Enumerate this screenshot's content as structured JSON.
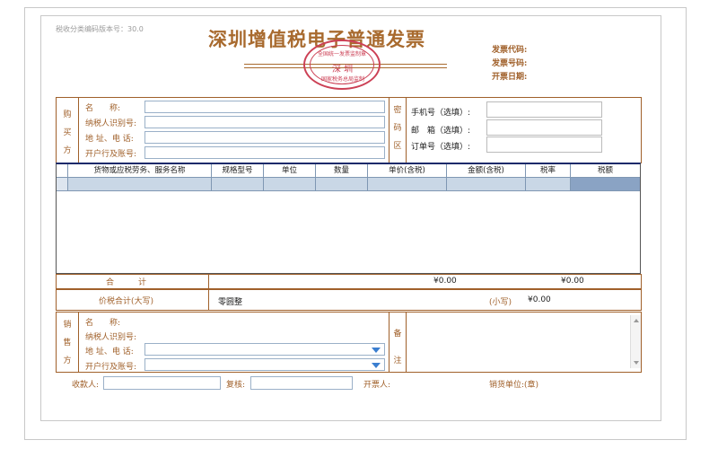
{
  "header": {
    "version_label": "税收分类编码版本号：30.0",
    "title_main": "深圳",
    "title_rest": "增值税电子普通发票",
    "invoice_code_label": "发票代码:",
    "invoice_number_label": "发票号码:",
    "issue_date_label": "开票日期:"
  },
  "seal": {
    "top_text": "全国统一发票监制章",
    "center_text": "深 圳",
    "bottom_text": "国家税务总局监制"
  },
  "buyer": {
    "side_label": [
      "购",
      "买",
      "方"
    ],
    "name_label": "名　　称:",
    "tax_id_label": "纳税人识别号:",
    "address_phone_label": "地 址、电 话:",
    "bank_account_label": "开户行及账号:"
  },
  "password_area": {
    "side_label": [
      "密",
      "码",
      "区"
    ],
    "phone_label": "手机号（选填）:",
    "email_label": "邮　箱（选填）:",
    "order_label": "订单号（选填）:"
  },
  "items_table": {
    "columns": [
      "货物或应税劳务、服务名称",
      "规格型号",
      "单位",
      "数量",
      "单价(含税)",
      "金额(含税)",
      "税率",
      "税额"
    ]
  },
  "totals": {
    "total_label": "合　　　计",
    "amount": "¥0.00",
    "tax": "¥0.00",
    "capital_label": "价税合计(大写)",
    "capital_value": "零圆整",
    "small_label": "(小写)",
    "small_value": "¥0.00"
  },
  "seller": {
    "side_label": [
      "销",
      "售",
      "方"
    ],
    "name_label": "名　　称:",
    "tax_id_label": "纳税人识别号:",
    "address_phone_label": "地 址、电 话:",
    "bank_account_label": "开户行及账号:"
  },
  "remarks": {
    "side_label": [
      "备",
      "注"
    ]
  },
  "footer": {
    "payee_label": "收款人:",
    "reviewer_label": "复核:",
    "drawer_label": "开票人:",
    "seller_unit_label": "销货单位:(章)"
  },
  "colors": {
    "accent": "#a0602a",
    "seal": "#cc4055",
    "grid_header_line": "#1a2a6a",
    "row_highlight": "#c9d7e6",
    "tax_cell": "#8aa3c4"
  }
}
